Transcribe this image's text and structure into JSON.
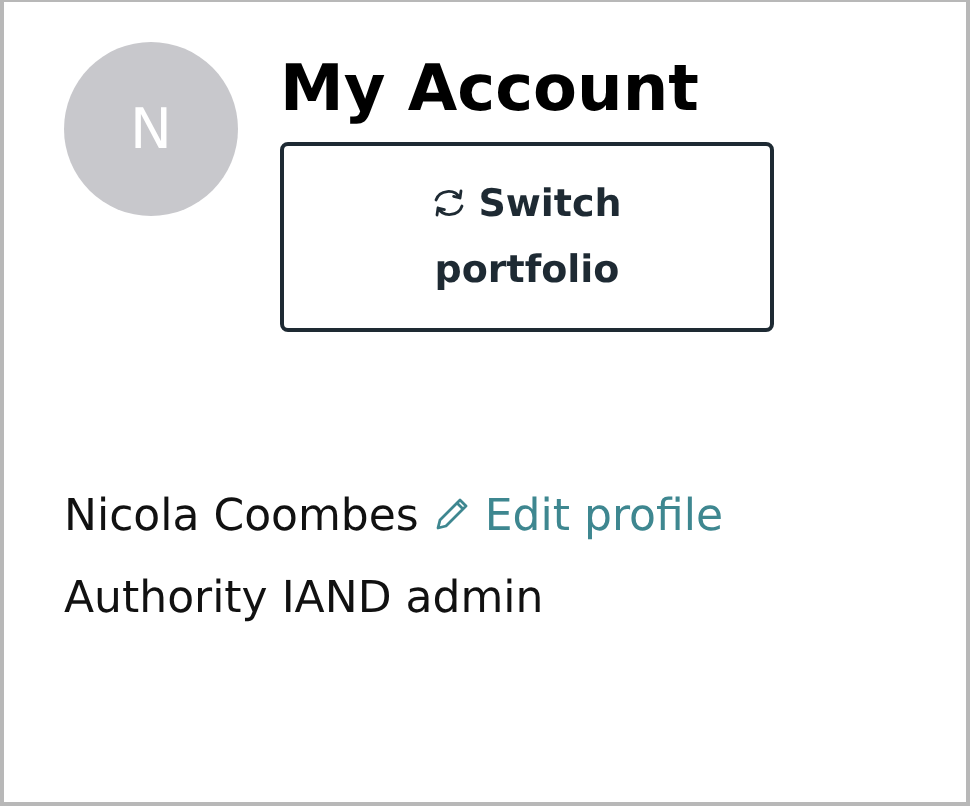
{
  "avatar": {
    "initial": "N"
  },
  "title": "My Account",
  "switch_button": {
    "label": "Switch portfolio"
  },
  "profile": {
    "name": "Nicola Coombes",
    "edit_link": "Edit profile",
    "role": "Authority IAND admin"
  }
}
